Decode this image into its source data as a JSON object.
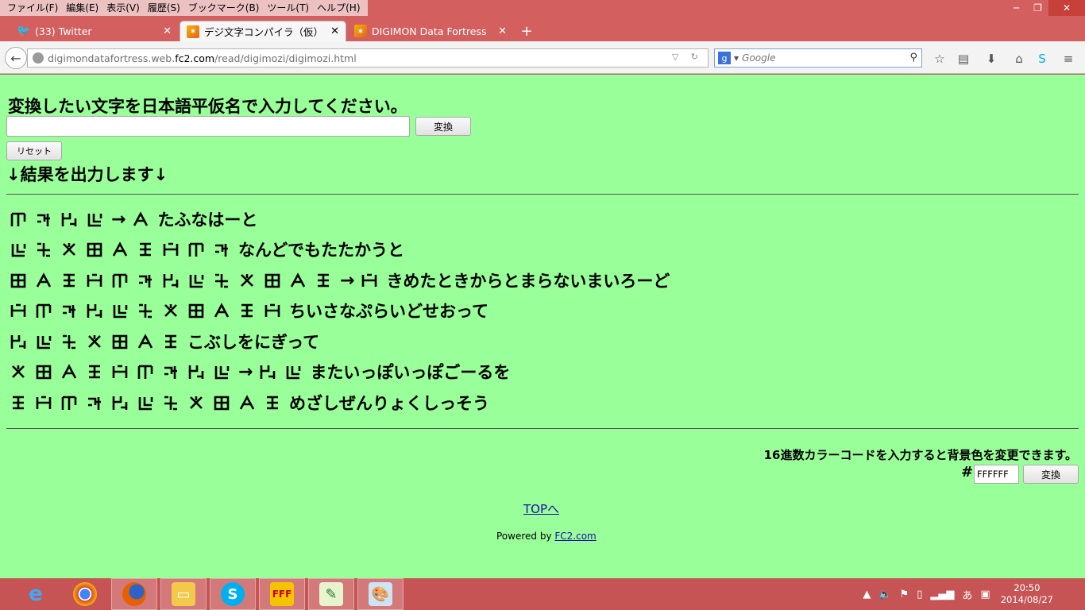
{
  "menu": [
    "ファイル(F)",
    "編集(E)",
    "表示(V)",
    "履歴(S)",
    "ブックマーク(B)",
    "ツール(T)",
    "ヘルプ(H)"
  ],
  "window_controls": {
    "minimize": "─",
    "restore": "❐",
    "close": "✕"
  },
  "tabs": [
    {
      "title": "(33) Twitter",
      "icon": "twitter-icon"
    },
    {
      "title": "デジ文字コンパイラ（仮）",
      "icon": "digimon-favicon"
    },
    {
      "title": "DIGIMON Data Fortress",
      "icon": "digimon-favicon"
    }
  ],
  "address": {
    "prefix": "digimondatafortress.web.",
    "host": "fc2.com",
    "path": "/read/digimozi/digimozi.html"
  },
  "search": {
    "placeholder": "Google"
  },
  "page": {
    "prompt": "変換したい文字を日本語平仮名で入力してください。",
    "input_value": "",
    "convert_label": "変換",
    "reset_label": "リセット",
    "result_heading": "↓結果を出力します↓",
    "results": [
      {
        "glyph_count": 4,
        "arrow": true,
        "after_arrow": 1,
        "kana": "たふなはーと"
      },
      {
        "glyph_count": 9,
        "arrow": false,
        "after_arrow": 0,
        "kana": "なんどでもたたかうと"
      },
      {
        "glyph_count": 13,
        "arrow": true,
        "after_arrow": 1,
        "kana": "きめたときからとまらないまいろーど"
      },
      {
        "glyph_count": 11,
        "arrow": false,
        "after_arrow": 0,
        "kana": "ちいさなぷらいどせおって"
      },
      {
        "glyph_count": 7,
        "arrow": false,
        "after_arrow": 0,
        "kana": "こぶしをにぎって"
      },
      {
        "glyph_count": 9,
        "arrow": true,
        "after_arrow": 2,
        "kana": "またいっぽいっぽごーるを"
      },
      {
        "glyph_count": 11,
        "arrow": false,
        "after_arrow": 0,
        "kana": "めざしぜんりょくしっそう"
      }
    ],
    "colorcode_note": "16進数カラーコードを入力すると背景色を変更できます。",
    "hash": "#",
    "color_value": "FFFFFF",
    "color_convert_label": "変換",
    "top_link": "TOPへ",
    "powered_prefix": "Powered by ",
    "powered_link": "FC2.com",
    "background_color": "#99ff99"
  },
  "taskbar": {
    "apps": [
      "ie-icon",
      "chrome-icon",
      "firefox-icon",
      "explorer-icon",
      "skype-icon",
      "ffftp-icon",
      "notepad-icon",
      "paint-icon"
    ],
    "time": "20:50",
    "date": "2014/08/27",
    "ime": "あ"
  }
}
